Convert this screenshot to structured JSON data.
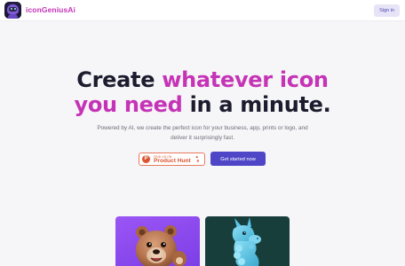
{
  "header": {
    "brand": "iconGeniusAi",
    "logo_icon": "robot-astronaut-logo-icon",
    "signin_label": "Sign in"
  },
  "hero": {
    "title_part1": "Create ",
    "title_accent1": "whatever icon",
    "title_accent2": "you need",
    "title_part2": " in a minute.",
    "subtitle": "Powered by AI, we create the perfect icon for your business, app, prints or logo, and deliver it surprisingly fast."
  },
  "product_hunt": {
    "small_text": "FIND US ON",
    "name": "Product Hunt",
    "logo_letter": "P",
    "arrow": "▲",
    "count": "9"
  },
  "cta": {
    "label": "Get started now"
  },
  "preview": {
    "cards": [
      {
        "icon": "bear-icon",
        "bg": "#8b4cf0"
      },
      {
        "icon": "llama-icon",
        "bg": "#173e3b"
      }
    ]
  },
  "colors": {
    "accent": "#c534b7",
    "primary": "#4f46c7",
    "producthunt": "#da552f"
  }
}
